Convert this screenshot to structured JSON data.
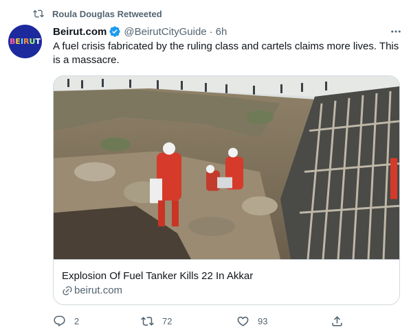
{
  "social_context": {
    "text": "Roula Douglas Retweeted",
    "icon": "retweet-icon"
  },
  "author": {
    "avatar_label": "BEIRUT",
    "display_name": "Beirut.com",
    "verified": true,
    "handle": "@BeirutCityGuide",
    "separator": "·",
    "time": "6h"
  },
  "tweet": {
    "text": "A fuel crisis fabricated by the ruling class and cartels claims more lives. This is a massacre."
  },
  "card": {
    "title": "Explosion Of Fuel Tanker Kills 22 In Akkar",
    "domain": "beirut.com",
    "image_icon": "news-photo"
  },
  "actions": {
    "reply_count": "2",
    "retweet_count": "72",
    "like_count": "93"
  },
  "colors": {
    "accent": "#1d9bf0",
    "secondary_text": "#536471",
    "border": "#cfd9de"
  }
}
